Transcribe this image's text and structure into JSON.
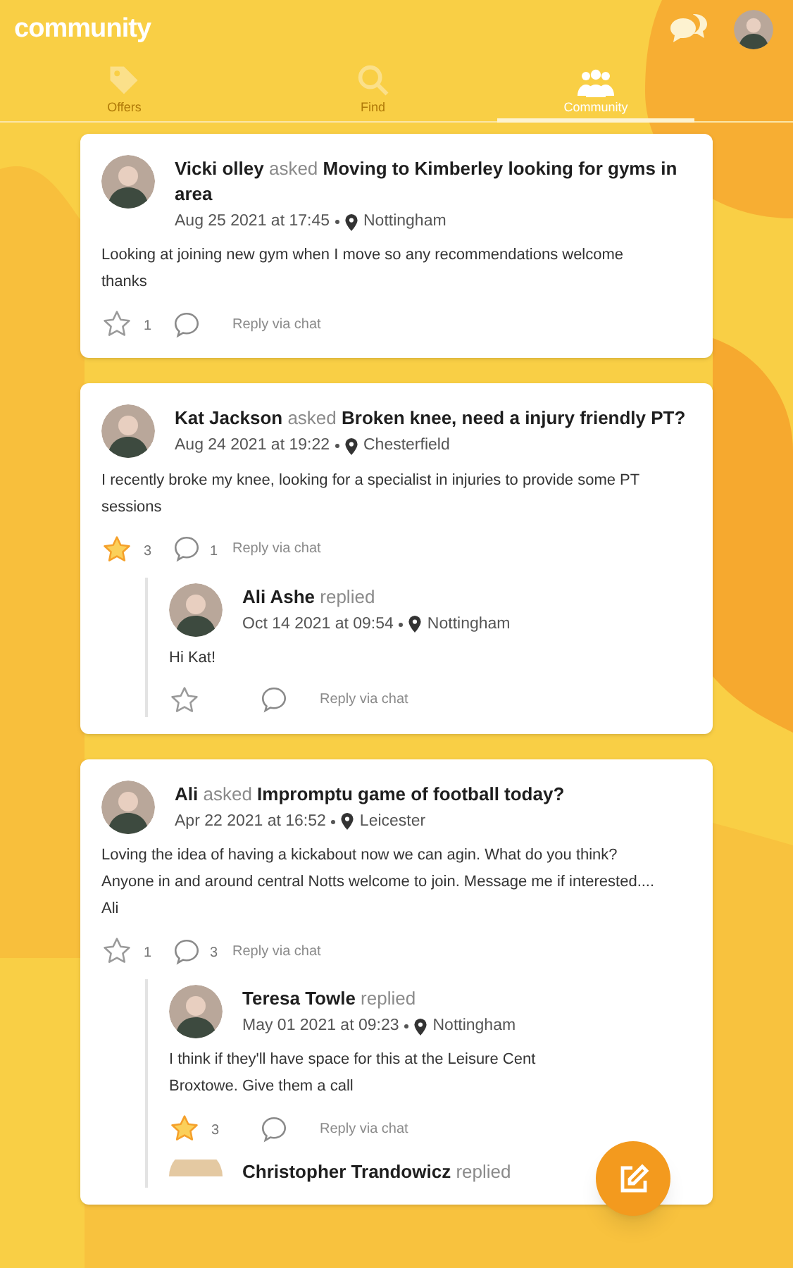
{
  "app_title": "community",
  "tabs": [
    {
      "label": "Offers",
      "kind": "tag",
      "selected": false
    },
    {
      "label": "Find",
      "kind": "search",
      "selected": false
    },
    {
      "label": "Community",
      "kind": "people",
      "selected": true
    }
  ],
  "posts": [
    {
      "heading": "**Vicki olley** asked **Moving to Kimberley looking for gyms in area**",
      "date": "Aug 25 2021 at 17:45",
      "location": "Nottingham",
      "body": "Looking at joining new gym when I move so any recommendations welcome thanks",
      "starred": false,
      "stars_count": "1",
      "reply_label": "Reply via chat"
    },
    {
      "heading": "**Kat Jackson** asked **Broken knee, need a injury friendly PT?**",
      "date": "Aug 24 2021 at 19:22",
      "location": "Chesterfield",
      "body": "I recently broke my knee, looking for a specialist in injuries to provide some PT sessions",
      "starred": true,
      "stars_count": "3",
      "comments_count": "1",
      "reply_label": "Reply via chat",
      "replies": [
        {
          "heading": "**Ali Ashe** replied",
          "date": "Oct 14 2021 at 09:54",
          "location": "Nottingham",
          "body": "Hi Kat!",
          "starred": false,
          "reply_label": "Reply via chat"
        }
      ]
    },
    {
      "heading": "**Ali** asked **Impromptu game of football today?**",
      "date": "Apr 22 2021 at 16:52",
      "location": "Leicester",
      "body": "Loving the idea of having a kickabout now we can agin. What do you think? Anyone in and around central Notts welcome to join. Message me if interested.... Ali",
      "starred": false,
      "stars_count": "1",
      "comments_count": "3",
      "reply_label": "Reply via chat",
      "replies": [
        {
          "heading": "**Teresa Towle** replied",
          "date": "May 01 2021 at 09:23",
          "location": "Nottingham",
          "body": "I think if they'll have space for this at the Leisure Cent\nBroxtowe. Give them a call",
          "starred": true,
          "stars_count": "3",
          "reply_label": "Reply via chat"
        },
        {
          "heading": "**Christopher Trandowicz** replied"
        }
      ]
    }
  ]
}
